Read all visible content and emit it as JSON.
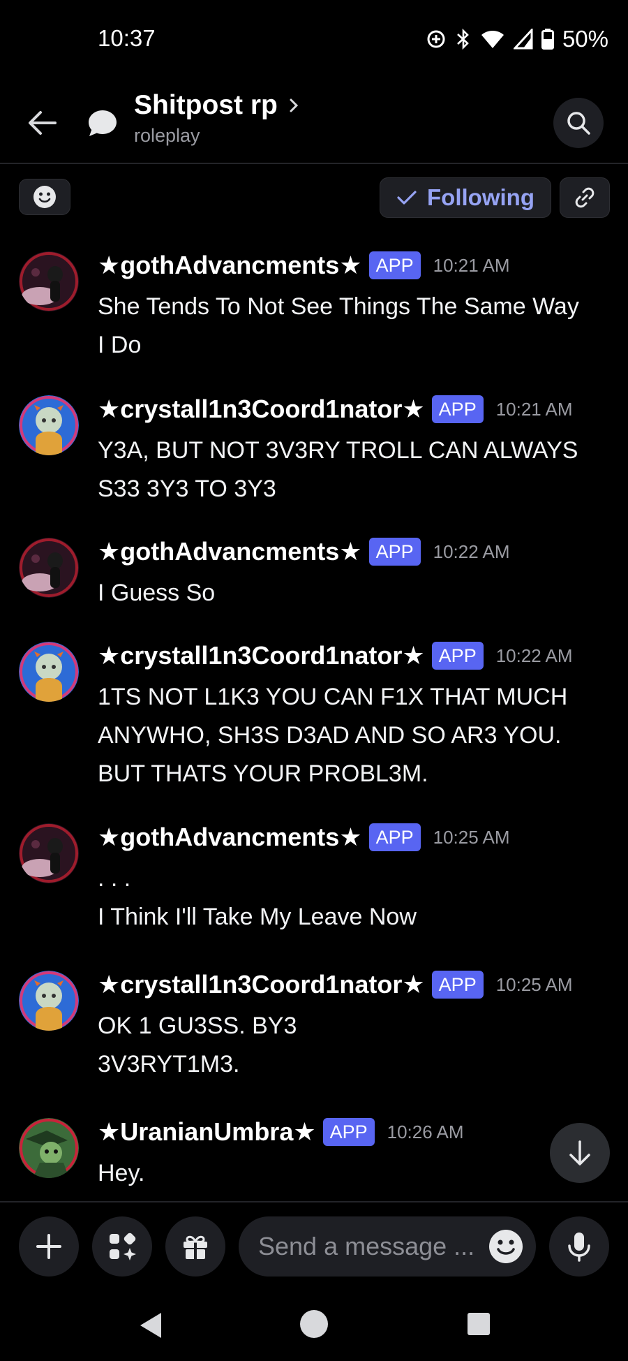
{
  "status_bar": {
    "time": "10:37",
    "battery": "50%"
  },
  "header": {
    "title": "Shitpost rp",
    "subtitle": "roleplay"
  },
  "actions": {
    "following_label": "Following"
  },
  "messages": [
    {
      "user": "★gothAdvancments★",
      "badge": "APP",
      "time": "10:21 AM",
      "lines": [
        "She Tends To Not See Things The Same Way",
        "I Do"
      ]
    },
    {
      "user": "★crystall1n3Coord1nator★",
      "badge": "APP",
      "time": "10:21 AM",
      "lines": [
        "Y3A, BUT NOT 3V3RY TROLL CAN ALWAYS",
        "S33 3Y3 TO 3Y3"
      ]
    },
    {
      "user": "★gothAdvancments★",
      "badge": "APP",
      "time": "10:22 AM",
      "lines": [
        "I Guess So"
      ]
    },
    {
      "user": "★crystall1n3Coord1nator★",
      "badge": "APP",
      "time": "10:22 AM",
      "lines": [
        "1TS NOT L1K3 YOU CAN F1X THAT MUCH",
        "ANYWHO, SH3S D3AD AND SO AR3 YOU.",
        "BUT THATS YOUR PROBL3M."
      ]
    },
    {
      "user": "★gothAdvancments★",
      "badge": "APP",
      "time": "10:25 AM",
      "lines": [
        ". . .",
        "I Think I'll Take My Leave Now"
      ]
    },
    {
      "user": "★crystall1n3Coord1nator★",
      "badge": "APP",
      "time": "10:25 AM",
      "lines": [
        "OK 1 GU3SS. BY3",
        "3V3RYT1M3."
      ]
    },
    {
      "user": "★UranianUmbra★",
      "badge": "APP",
      "time": "10:26 AM",
      "lines": [
        "Hey."
      ]
    }
  ],
  "composer": {
    "placeholder": "Send a message ..."
  },
  "colors": {
    "background": "#000000",
    "accent": "#5865f2",
    "following": "#96a3f3",
    "muted": "#9a9ba2"
  }
}
